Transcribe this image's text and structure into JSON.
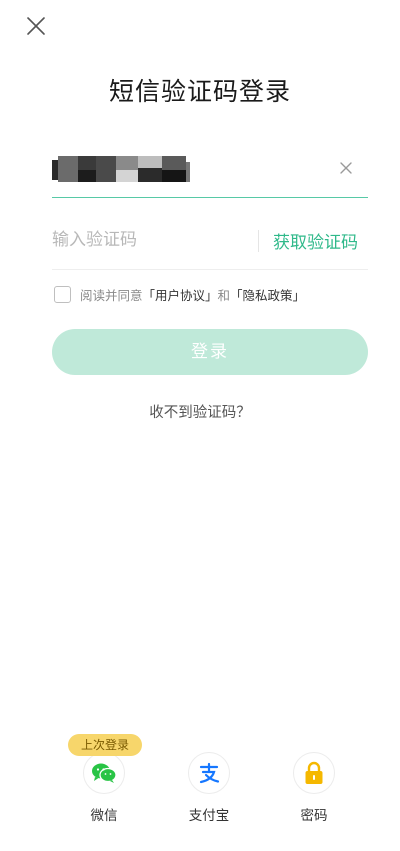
{
  "header": {
    "close_icon": "close-icon",
    "title": "短信验证码登录"
  },
  "form": {
    "phone_masked": true,
    "clear_icon": "clear-icon",
    "code_placeholder": "输入验证码",
    "code_value": "",
    "get_code_label": "获取验证码",
    "agree_checked": false,
    "agree_prefix": "阅读并同意",
    "user_agreement_label": "「用户协议」",
    "agree_and": "和",
    "privacy_policy_label": "「隐私政策」",
    "login_label": "登录",
    "no_code_label": "收不到验证码？"
  },
  "colors": {
    "accent": "#2fb98a",
    "underline": "#57c9a6",
    "login_disabled_bg": "#bfe9d9",
    "badge_bg": "#f7d66b",
    "wechat": "#28c445",
    "alipay": "#1677ff",
    "password_lock": "#f5b800"
  },
  "alt_login": {
    "last_login_badge": "上次登录",
    "options": [
      {
        "label": "微信",
        "icon": "wechat-icon"
      },
      {
        "label": "支付宝",
        "icon": "alipay-icon"
      },
      {
        "label": "密码",
        "icon": "lock-icon"
      }
    ]
  }
}
